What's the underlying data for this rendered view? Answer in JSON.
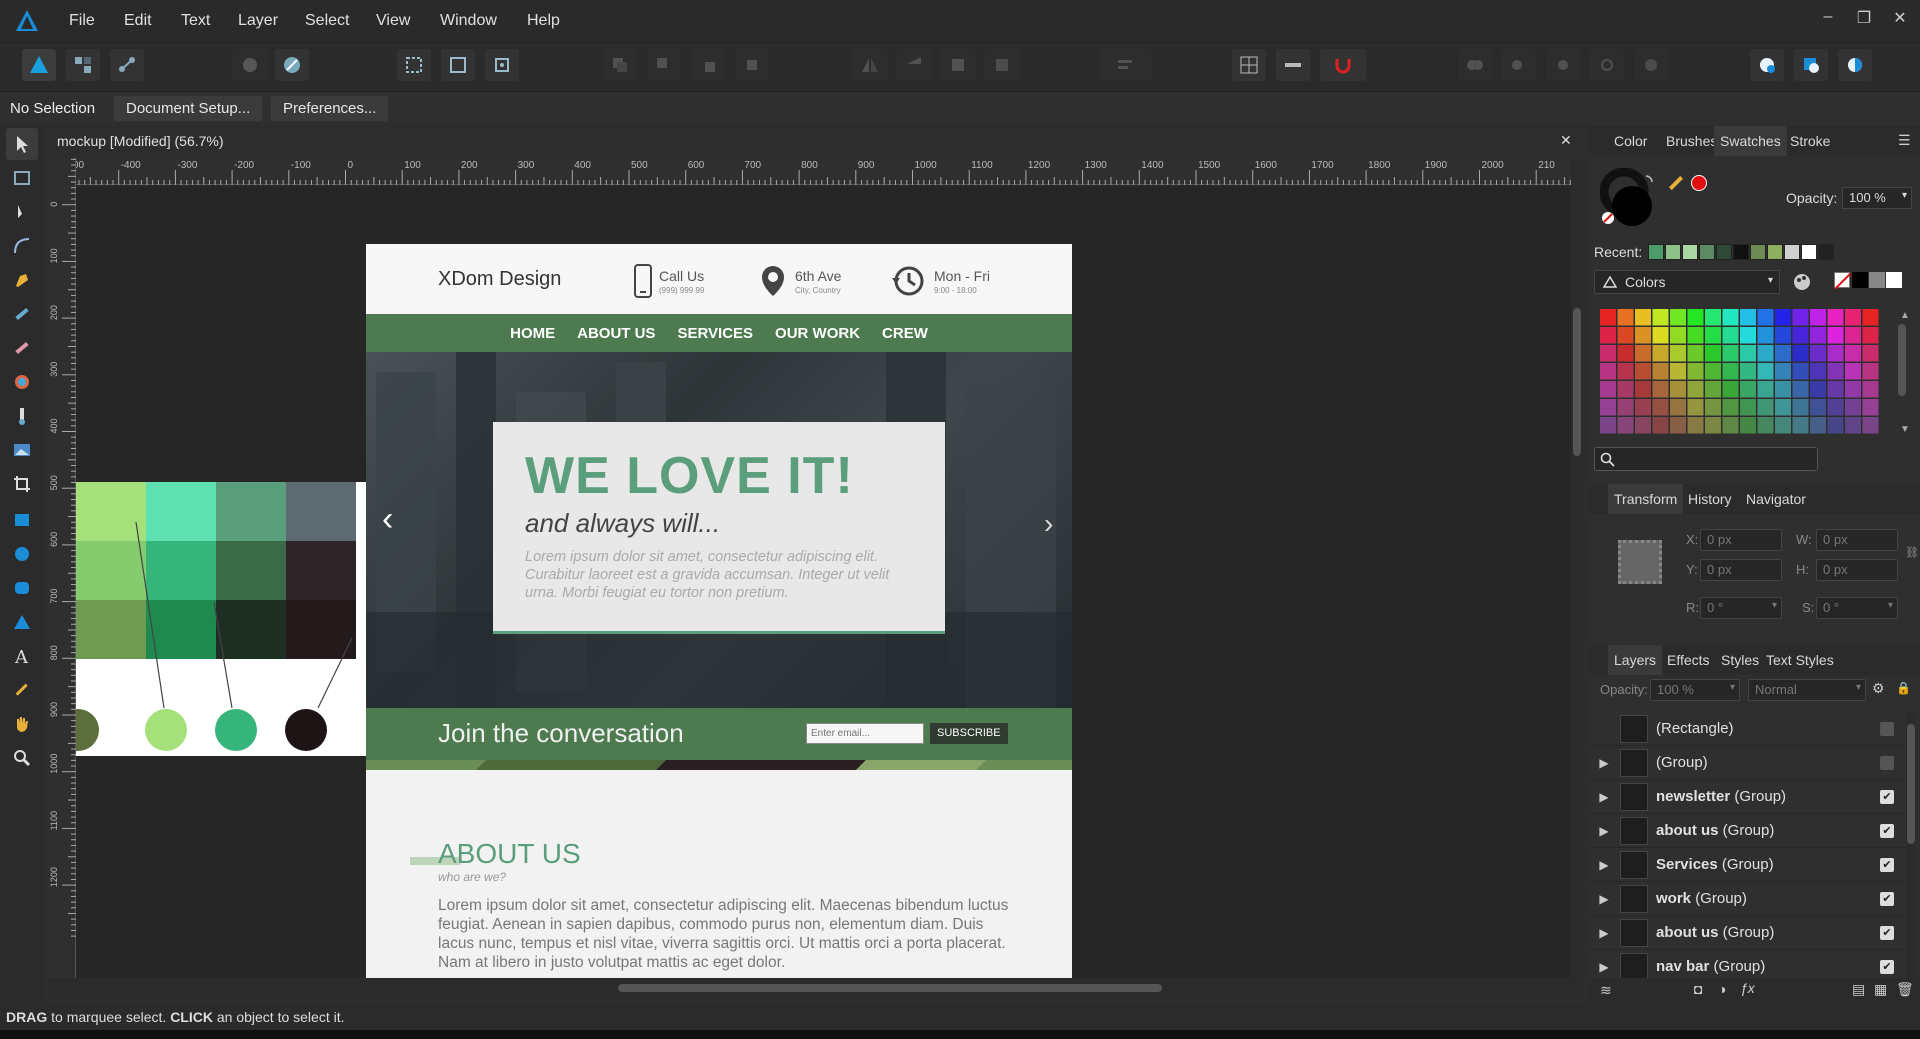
{
  "menubar": {
    "items": [
      "File",
      "Edit",
      "Text",
      "Layer",
      "Select",
      "View",
      "Window",
      "Help"
    ],
    "window_controls": [
      "–",
      "❐",
      "✕"
    ]
  },
  "context": {
    "selection": "No Selection",
    "doc_setup": "Document Setup...",
    "preferences": "Preferences..."
  },
  "document": {
    "tab_title": "mockup [Modified] (56.7%)",
    "close": "✕",
    "ruler_unit": "px",
    "ruler_top": [
      "-500",
      "-400",
      "-300",
      "-200",
      "-100",
      "0",
      "100",
      "200",
      "300",
      "400",
      "500",
      "600",
      "700",
      "800",
      "900",
      "1000",
      "1100",
      "1200",
      "1300",
      "1400",
      "1500",
      "1600",
      "1700",
      "1800",
      "1900",
      "2000",
      "210"
    ],
    "ruler_left": [
      "100",
      "0",
      "100",
      "200",
      "300",
      "400",
      "500",
      "600",
      "700",
      "800",
      "900",
      "1000",
      "1100",
      "1200"
    ]
  },
  "mockup": {
    "brand": "XDom Design",
    "contact": [
      {
        "title": "Call Us",
        "sub": "(999) 999 99"
      },
      {
        "title": "6th Ave",
        "sub": "City, Country"
      },
      {
        "title": "Mon - Fri",
        "sub": "9:00 - 18:00"
      }
    ],
    "nav": [
      "HOME",
      "ABOUT US",
      "SERVICES",
      "OUR WORK",
      "CREW"
    ],
    "hero_title": "WE LOVE IT!",
    "hero_sub": "and always will...",
    "hero_text": "Lorem ipsum dolor sit amet, consectetur adipiscing elit. Curabitur laoreet est a gravida accumsan. Integer ut velit urna. Morbi feugiat eu tortor non pretium.",
    "newsletter_title": "Join the conversation",
    "newsletter_placeholder": "Enter email...",
    "subscribe": "SUBSCRIBE",
    "about_title": "ABOUT US",
    "about_sub": "who are we?",
    "about_text": "Lorem ipsum dolor sit amet, consectetur adipiscing elit. Maecenas bibendum luctus feugiat. Aenean in sapien dapibus, commodo purus non, elementum diam. Duis lacus nunc, tempus et nisl vitae, viverra sagittis orci. Ut mattis orci a porta placerat. Nam at libero in justo volutpat mattis ac eget dolor.",
    "arrow_left": "‹",
    "arrow_right": "›"
  },
  "palette_colors": [
    "#a5e07a",
    "#5fe0b0",
    "#5a9e7c",
    "#5d6a72",
    "#84cc6e",
    "#35b57a",
    "#3a6a48",
    "#2e2528",
    "#6e9a52",
    "#1f8a4e",
    "#1d2e22",
    "#241a1c"
  ],
  "color_panel": {
    "tabs": [
      "Color",
      "Brushes",
      "Swatches",
      "Stroke"
    ],
    "opacity_label": "Opacity:",
    "opacity_value": "100 %",
    "recent_label": "Recent:",
    "recent": [
      "#4f9a6a",
      "#8ec08a",
      "#a9d6a2",
      "#5b8a63",
      "#2f4a38",
      "#111111",
      "#6f8a55",
      "#8fb060",
      "#cfcfcf",
      "#ffffff",
      "#222222"
    ],
    "palette_name": "Colors"
  },
  "transform_panel": {
    "tabs": [
      "Transform",
      "History",
      "Navigator"
    ],
    "x_label": "X:",
    "x": "0 px",
    "y_label": "Y:",
    "y": "0 px",
    "w_label": "W:",
    "w": "0 px",
    "h_label": "H:",
    "h": "0 px",
    "r_label": "R:",
    "r": "0 °",
    "s_label": "S:",
    "s": "0 °"
  },
  "layers_panel": {
    "tabs": [
      "Layers",
      "Effects",
      "Styles",
      "Text Styles"
    ],
    "opacity_label": "Opacity:",
    "opacity": "100 %",
    "blend": "Normal",
    "rows": [
      {
        "name": "(Rectangle)",
        "bold": "",
        "expand": false,
        "visible": false
      },
      {
        "name": "(Group)",
        "bold": "",
        "expand": true,
        "visible": false
      },
      {
        "name": "(Group)",
        "bold": "newsletter",
        "expand": true,
        "visible": true
      },
      {
        "name": "(Group)",
        "bold": "about us",
        "expand": true,
        "visible": true
      },
      {
        "name": "(Group)",
        "bold": "Services",
        "expand": true,
        "visible": true
      },
      {
        "name": "(Group)",
        "bold": "work",
        "expand": true,
        "visible": true
      },
      {
        "name": "(Group)",
        "bold": "about us",
        "expand": true,
        "visible": true
      },
      {
        "name": "(Group)",
        "bold": "nav bar",
        "expand": true,
        "visible": true
      }
    ]
  },
  "status": {
    "drag": "DRAG",
    "drag_text": " to marquee select. ",
    "click": "CLICK",
    "click_text": " an object to select it."
  },
  "colors": {
    "green_dark": "#4d7a4f",
    "green_title": "#5a9e7c",
    "accent_red": "#e01010"
  }
}
